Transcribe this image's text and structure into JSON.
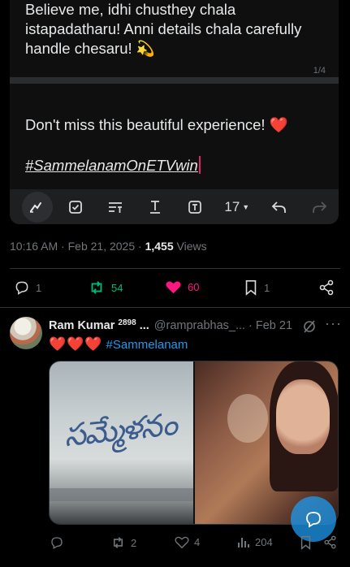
{
  "note": {
    "paragraph_1": "Believe me, idhi chusthey chala\nistapadatharu! Anni details chala carefully\nhandle chesaru! 💫",
    "page_indicator": "1/4",
    "paragraph_2": "Don't miss this beautiful experience!",
    "paragraph_2_emoji": "❤️",
    "hashtag": "#SammelanamOnETVwin",
    "toolbar": {
      "font_size": "17",
      "icons": [
        "pen-icon",
        "checkbox-icon",
        "text-format-icon",
        "underline-text-icon",
        "text-box-icon",
        "font-size-select",
        "undo-icon",
        "redo-icon"
      ]
    }
  },
  "post_meta": {
    "time": "10:16 AM",
    "date": "Feb 21, 2025",
    "views_count": "1,455",
    "views_label": "Views"
  },
  "post_actions": {
    "replies": "1",
    "reposts": "54",
    "likes": "60",
    "bookmarks": "1",
    "colors": {
      "repost": "#00ba7c",
      "like": "#f91880",
      "default": "#71767b"
    }
  },
  "reply": {
    "author_name": "Ram Kumar",
    "author_sup": "2898",
    "author_ellipsis": "...",
    "handle": "@ramprabhas_...",
    "date": "Feb 21",
    "hearts": "❤️❤️❤️",
    "hashtag": "#Sammelanam",
    "media_logo_text": "సమ్మేళనం",
    "actions": {
      "replies": "",
      "reposts": "2",
      "likes": "4",
      "views": "204"
    }
  }
}
